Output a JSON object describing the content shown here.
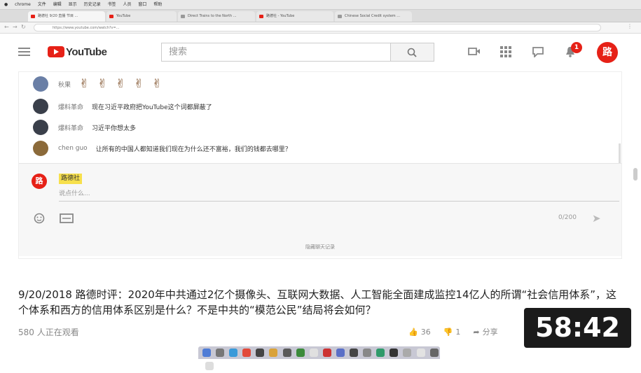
{
  "mac_menu": [
    "chrome",
    "文件",
    "编辑",
    "显示",
    "历史记录",
    "书签",
    "人员",
    "窗口",
    "帮助"
  ],
  "browser": {
    "tabs": [
      {
        "label": "路德社 9/20 直播 节目 ..."
      },
      {
        "label": "YouTube"
      },
      {
        "label": "Direct Trains to the North ..."
      },
      {
        "label": "路德社 - YouTube"
      },
      {
        "label": "Chinese Social Credit system ..."
      }
    ],
    "url": "https://www.youtube.com/watch?v=..."
  },
  "header": {
    "logo_text": "YouTube",
    "search_placeholder": "搜索",
    "notification_count": "1",
    "user_avatar_text": "路"
  },
  "chat": {
    "messages": [
      {
        "author": "秋果",
        "text": ""
      },
      {
        "author": "爆料革命",
        "text": "现在习近平政府把YouTube这个词都屏蔽了"
      },
      {
        "author": "爆料革命",
        "text": "习近平你想太多"
      },
      {
        "author": "chen guo",
        "text": "让所有的中国人都知道我们现在为什么还不富裕，我们的钱都去哪里？"
      }
    ],
    "emoji_row": [
      "✌",
      "✌",
      "✌",
      "✌",
      "✌"
    ],
    "me": {
      "avatar_text": "路",
      "name": "路德社",
      "placeholder": "说点什么..."
    },
    "counter": "0/200",
    "hide_label": "隐藏聊天记录"
  },
  "video": {
    "title": "9/20/2018 路德时评：2020年中共通过2亿个摄像头、互联网大数据、人工智能全面建成监控14亿人的所谓“社会信用体系”，这个体系和西方的信用体系区别是什么？不是中共的“模范公民”结局将会如何？",
    "views": "580 人正在观看",
    "likes": "36",
    "dislikes": "1",
    "share": "分享"
  },
  "duration": "58:42",
  "colors": {
    "brand": "#e62117",
    "highlight": "#f7e04c"
  }
}
